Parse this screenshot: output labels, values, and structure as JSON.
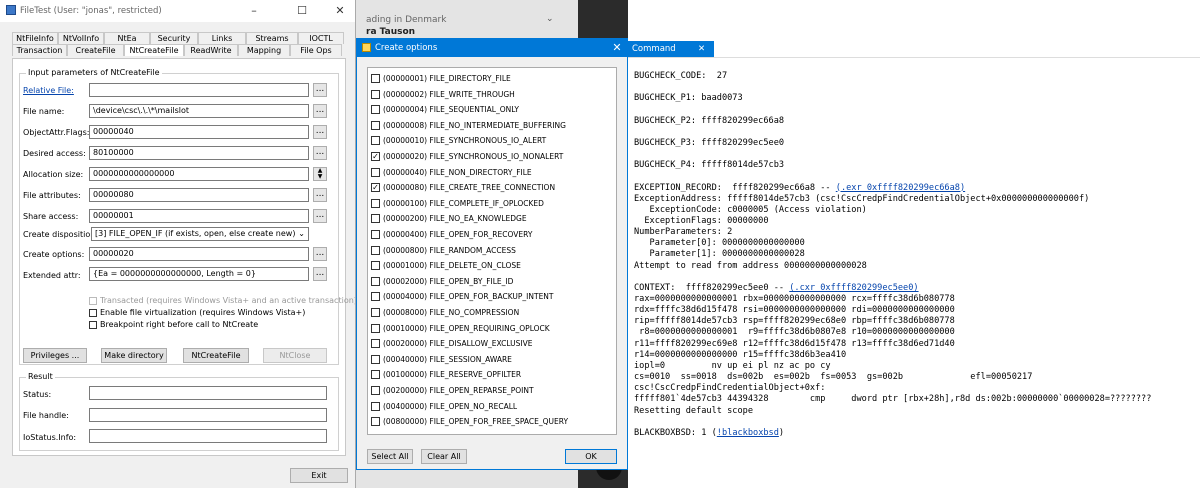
{
  "filetest": {
    "title": "FileTest (User: \"jonas\", restricted)",
    "window_buttons": [
      "–",
      "☐",
      "✕"
    ],
    "tabs_row1": [
      "NtFileInfo",
      "NtVolInfo",
      "NtEa",
      "Security",
      "Links",
      "Streams",
      "IOCTL"
    ],
    "tabs_row2": [
      "Transaction",
      "CreateFile",
      "NtCreateFile",
      "ReadWrite",
      "Mapping",
      "File Ops"
    ],
    "active_tab": "NtCreateFile",
    "input_group_title": "Input parameters of NtCreateFile",
    "fields": {
      "relative_file": {
        "label": "Relative File:",
        "value": ""
      },
      "file_name": {
        "label": "File name:",
        "value": "\\device\\csc\\.\\.\\*\\mailslot"
      },
      "objattr_flags": {
        "label": "ObjectAttr.Flags:",
        "value": "00000040"
      },
      "desired_access": {
        "label": "Desired access:",
        "value": "80100000"
      },
      "allocation_size": {
        "label": "Allocation size:",
        "value": "0000000000000000"
      },
      "file_attributes": {
        "label": "File attributes:",
        "value": "00000080"
      },
      "share_access": {
        "label": "Share access:",
        "value": "00000001"
      },
      "create_disposition": {
        "label": "Create disposition:",
        "value": "[3] FILE_OPEN_IF (if exists, open, else create new)"
      },
      "create_options": {
        "label": "Create options:",
        "value": "00000020"
      },
      "extended_attr": {
        "label": "Extended attr:",
        "value": "{Ea = 0000000000000000, Length = 0}"
      }
    },
    "dots_label": "...",
    "checkboxes": {
      "transacted": "Transacted (requires Windows Vista+ and an active transaction)",
      "virtualization": "Enable file virtualization (requires Windows Vista+)",
      "breakpoint": "Breakpoint right before call to NtCreate"
    },
    "buttons": {
      "privileges": "Privileges ...",
      "make_directory": "Make directory",
      "ntcreatefile": "NtCreateFile",
      "ntclose": "NtClose",
      "exit": "Exit"
    },
    "result_group_title": "Result",
    "result_fields": {
      "status": {
        "label": "Status:",
        "value": ""
      },
      "file_handle": {
        "label": "File handle:",
        "value": ""
      },
      "iostatus_info": {
        "label": "IoStatus.Info:",
        "value": ""
      }
    }
  },
  "background": {
    "line1": "ading in Denmark",
    "line2": "ra Tauson",
    "chevron": "⌄"
  },
  "create_options_dialog": {
    "title": "Create options",
    "close": "✕",
    "options": [
      {
        "label": "(00000001) FILE_DIRECTORY_FILE",
        "checked": false
      },
      {
        "label": "(00000002) FILE_WRITE_THROUGH",
        "checked": false
      },
      {
        "label": "(00000004) FILE_SEQUENTIAL_ONLY",
        "checked": false
      },
      {
        "label": "(00000008) FILE_NO_INTERMEDIATE_BUFFERING",
        "checked": false
      },
      {
        "label": "(00000010) FILE_SYNCHRONOUS_IO_ALERT",
        "checked": false
      },
      {
        "label": "(00000020) FILE_SYNCHRONOUS_IO_NONALERT",
        "checked": true
      },
      {
        "label": "(00000040) FILE_NON_DIRECTORY_FILE",
        "checked": false
      },
      {
        "label": "(00000080) FILE_CREATE_TREE_CONNECTION",
        "checked": true
      },
      {
        "label": "(00000100) FILE_COMPLETE_IF_OPLOCKED",
        "checked": false
      },
      {
        "label": "(00000200) FILE_NO_EA_KNOWLEDGE",
        "checked": false
      },
      {
        "label": "(00000400) FILE_OPEN_FOR_RECOVERY",
        "checked": false
      },
      {
        "label": "(00000800) FILE_RANDOM_ACCESS",
        "checked": false
      },
      {
        "label": "(00001000) FILE_DELETE_ON_CLOSE",
        "checked": false
      },
      {
        "label": "(00002000) FILE_OPEN_BY_FILE_ID",
        "checked": false
      },
      {
        "label": "(00004000) FILE_OPEN_FOR_BACKUP_INTENT",
        "checked": false
      },
      {
        "label": "(00008000) FILE_NO_COMPRESSION",
        "checked": false
      },
      {
        "label": "(00010000) FILE_OPEN_REQUIRING_OPLOCK",
        "checked": false
      },
      {
        "label": "(00020000) FILE_DISALLOW_EXCLUSIVE",
        "checked": false
      },
      {
        "label": "(00040000) FILE_SESSION_AWARE",
        "checked": false
      },
      {
        "label": "(00100000) FILE_RESERVE_OPFILTER",
        "checked": false
      },
      {
        "label": "(00200000) FILE_OPEN_REPARSE_POINT",
        "checked": false
      },
      {
        "label": "(00400000) FILE_OPEN_NO_RECALL",
        "checked": false
      },
      {
        "label": "(00800000) FILE_OPEN_FOR_FREE_SPACE_QUERY",
        "checked": false
      }
    ],
    "buttons": {
      "select_all": "Select All",
      "clear_all": "Clear All",
      "ok": "OK"
    }
  },
  "command_window": {
    "tab_label": "Command",
    "tab_close": "✕",
    "lines": [
      "BUGCHECK_CODE:  27",
      "",
      "BUGCHECK_P1: baad0073",
      "",
      "BUGCHECK_P2: ffff820299ec66a8",
      "",
      "BUGCHECK_P3: ffff820299ec5ee0",
      "",
      "BUGCHECK_P4: fffff8014de57cb3",
      "",
      "EXCEPTION_RECORD:  ffff820299ec66a8 -- ",
      "ExceptionAddress: fffff8014de57cb3 (csc!CscCredpFindCredentialObject+0x000000000000000f)",
      "   ExceptionCode: c0000005 (Access violation)",
      "  ExceptionFlags: 00000000",
      "NumberParameters: 2",
      "   Parameter[0]: 0000000000000000",
      "   Parameter[1]: 0000000000000028",
      "Attempt to read from address 0000000000000028",
      "",
      "CONTEXT:  ffff820299ec5ee0 -- ",
      "rax=0000000000000001 rbx=0000000000000000 rcx=ffffc38d6b080778",
      "rdx=ffffc38d6d15f478 rsi=0000000000000000 rdi=0000000000000000",
      "rip=fffff8014de57cb3 rsp=ffff820299ec68e0 rbp=ffffc38d6b080778",
      " r8=0000000000000001  r9=ffffc38d6b0807e8 r10=0000000000000000",
      "r11=ffff820299ec69e8 r12=ffffc38d6d15f478 r13=ffffc38d6ed71d40",
      "r14=0000000000000000 r15=ffffc38d6b3ea410",
      "iopl=0         nv up ei pl nz ac po cy",
      "cs=0010  ss=0018  ds=002b  es=002b  fs=0053  gs=002b             efl=00050217",
      "csc!CscCredpFindCredentialObject+0xf:",
      "fffff801`4de57cb3 44394328        cmp     dword ptr [rbx+28h],r8d ds:002b:00000000`00000028=????????",
      "Resetting default scope",
      "",
      "BLACKBOXBSD: 1 ("
    ],
    "exr_link": "(.exr 0xffff820299ec66a8)",
    "cxr_link": "(.cxr 0xffff820299ec5ee0)",
    "blackbox_link": "!blackboxbsd",
    "blackbox_tail": ")"
  }
}
